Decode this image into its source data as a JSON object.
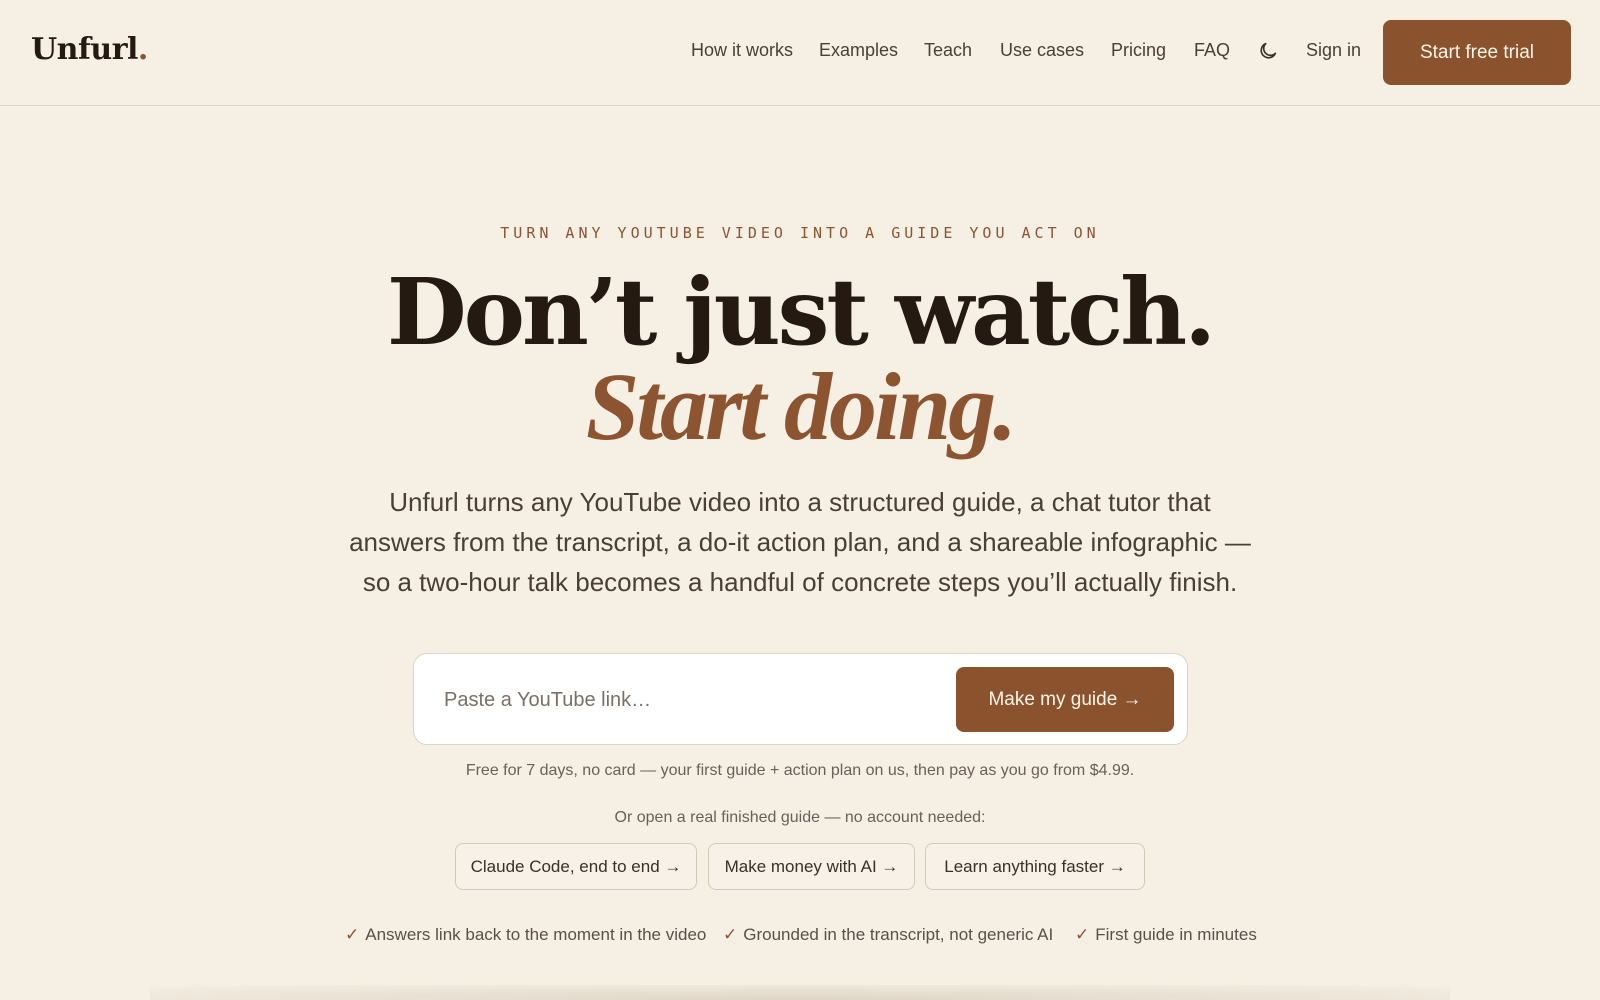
{
  "header": {
    "logo": "Unfurl",
    "logo_dot": ".",
    "nav": [
      {
        "label": "How it works"
      },
      {
        "label": "Examples"
      },
      {
        "label": "Teach"
      },
      {
        "label": "Use cases"
      },
      {
        "label": "Pricing"
      },
      {
        "label": "FAQ"
      }
    ],
    "theme_icon": "moon-icon",
    "sign_in": "Sign in",
    "cta": "Start free trial"
  },
  "hero": {
    "eyebrow": "TURN ANY YOUTUBE VIDEO INTO A GUIDE YOU ACT ON",
    "headline_1": "Don’t just watch.",
    "headline_2": "Start doing.",
    "subtitle": "Unfurl turns any YouTube video into a structured guide, a chat tutor that answers from the transcript, a do-it action plan, and a shareable infographic — so a two-hour talk becomes a handful of concrete steps you’ll actually finish."
  },
  "form": {
    "placeholder": "Paste a YouTube link…",
    "value": "",
    "button": "Make my guide →"
  },
  "fine_print": "Free for 7 days, no card — your first guide + action plan on us, then pay as you go from $4.99.",
  "examples": {
    "intro": "Or open a real finished guide — no account needed:",
    "chips": [
      {
        "label": "Claude Code, end to end →"
      },
      {
        "label": "Make money with AI →"
      },
      {
        "label": "Learn anything faster →"
      }
    ]
  },
  "checks": [
    {
      "icon": "✓",
      "label": "Answers link back to the moment in the video"
    },
    {
      "icon": "✓",
      "label": "Grounded in the transcript, not generic AI"
    },
    {
      "icon": "✓",
      "label": "First guide in minutes"
    }
  ],
  "colors": {
    "background": "#f5efe4",
    "accent": "#8a522d",
    "text": "#241a12"
  }
}
